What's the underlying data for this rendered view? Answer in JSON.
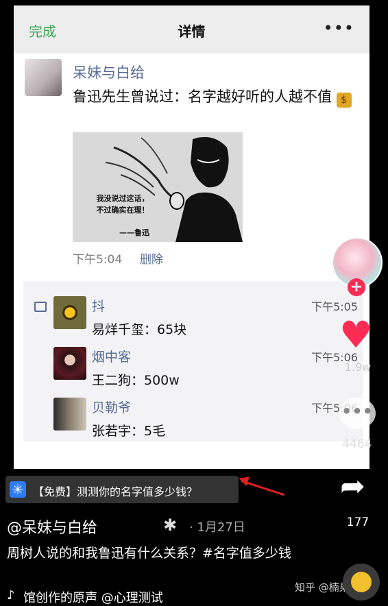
{
  "card": {
    "done": "完成",
    "title": "详情",
    "more": "•••",
    "author": "呆妹与白给",
    "text": "鲁迅先生曾说过：名字越好听的人越不值",
    "money_icon": "money-bag-icon",
    "image": {
      "quote_line1": "我没说过这话，",
      "quote_line2": "不过确实在理！",
      "sign": "——鲁迅"
    },
    "time": "下午5:04",
    "delete": "删除",
    "comments": [
      {
        "name": "抖",
        "time": "下午5:05",
        "text": "易烊千玺：65块"
      },
      {
        "name": "烟中客",
        "time": "下午5:06",
        "text": "王二狗：500w"
      },
      {
        "name": "贝勒爷",
        "time": "下午5:06",
        "text": "张若宇：5毛"
      }
    ]
  },
  "overlay": {
    "like_count": "1.9w",
    "comment_count": "4464",
    "share_count": "177",
    "miniapp": "【免费】测测你的名字值多少钱？",
    "author": "@呆妹与白给",
    "date": "· 1月27日",
    "caption": "周树人说的和我鲁迅有什么关系？#名字值多少钱",
    "music": "馆创作的原声    @心理测试",
    "watermark": "知乎 @楠果收藏"
  },
  "colors": {
    "accent_red": "#fe2c55",
    "wechat_link": "#576b95",
    "wechat_green": "#3aa655"
  }
}
